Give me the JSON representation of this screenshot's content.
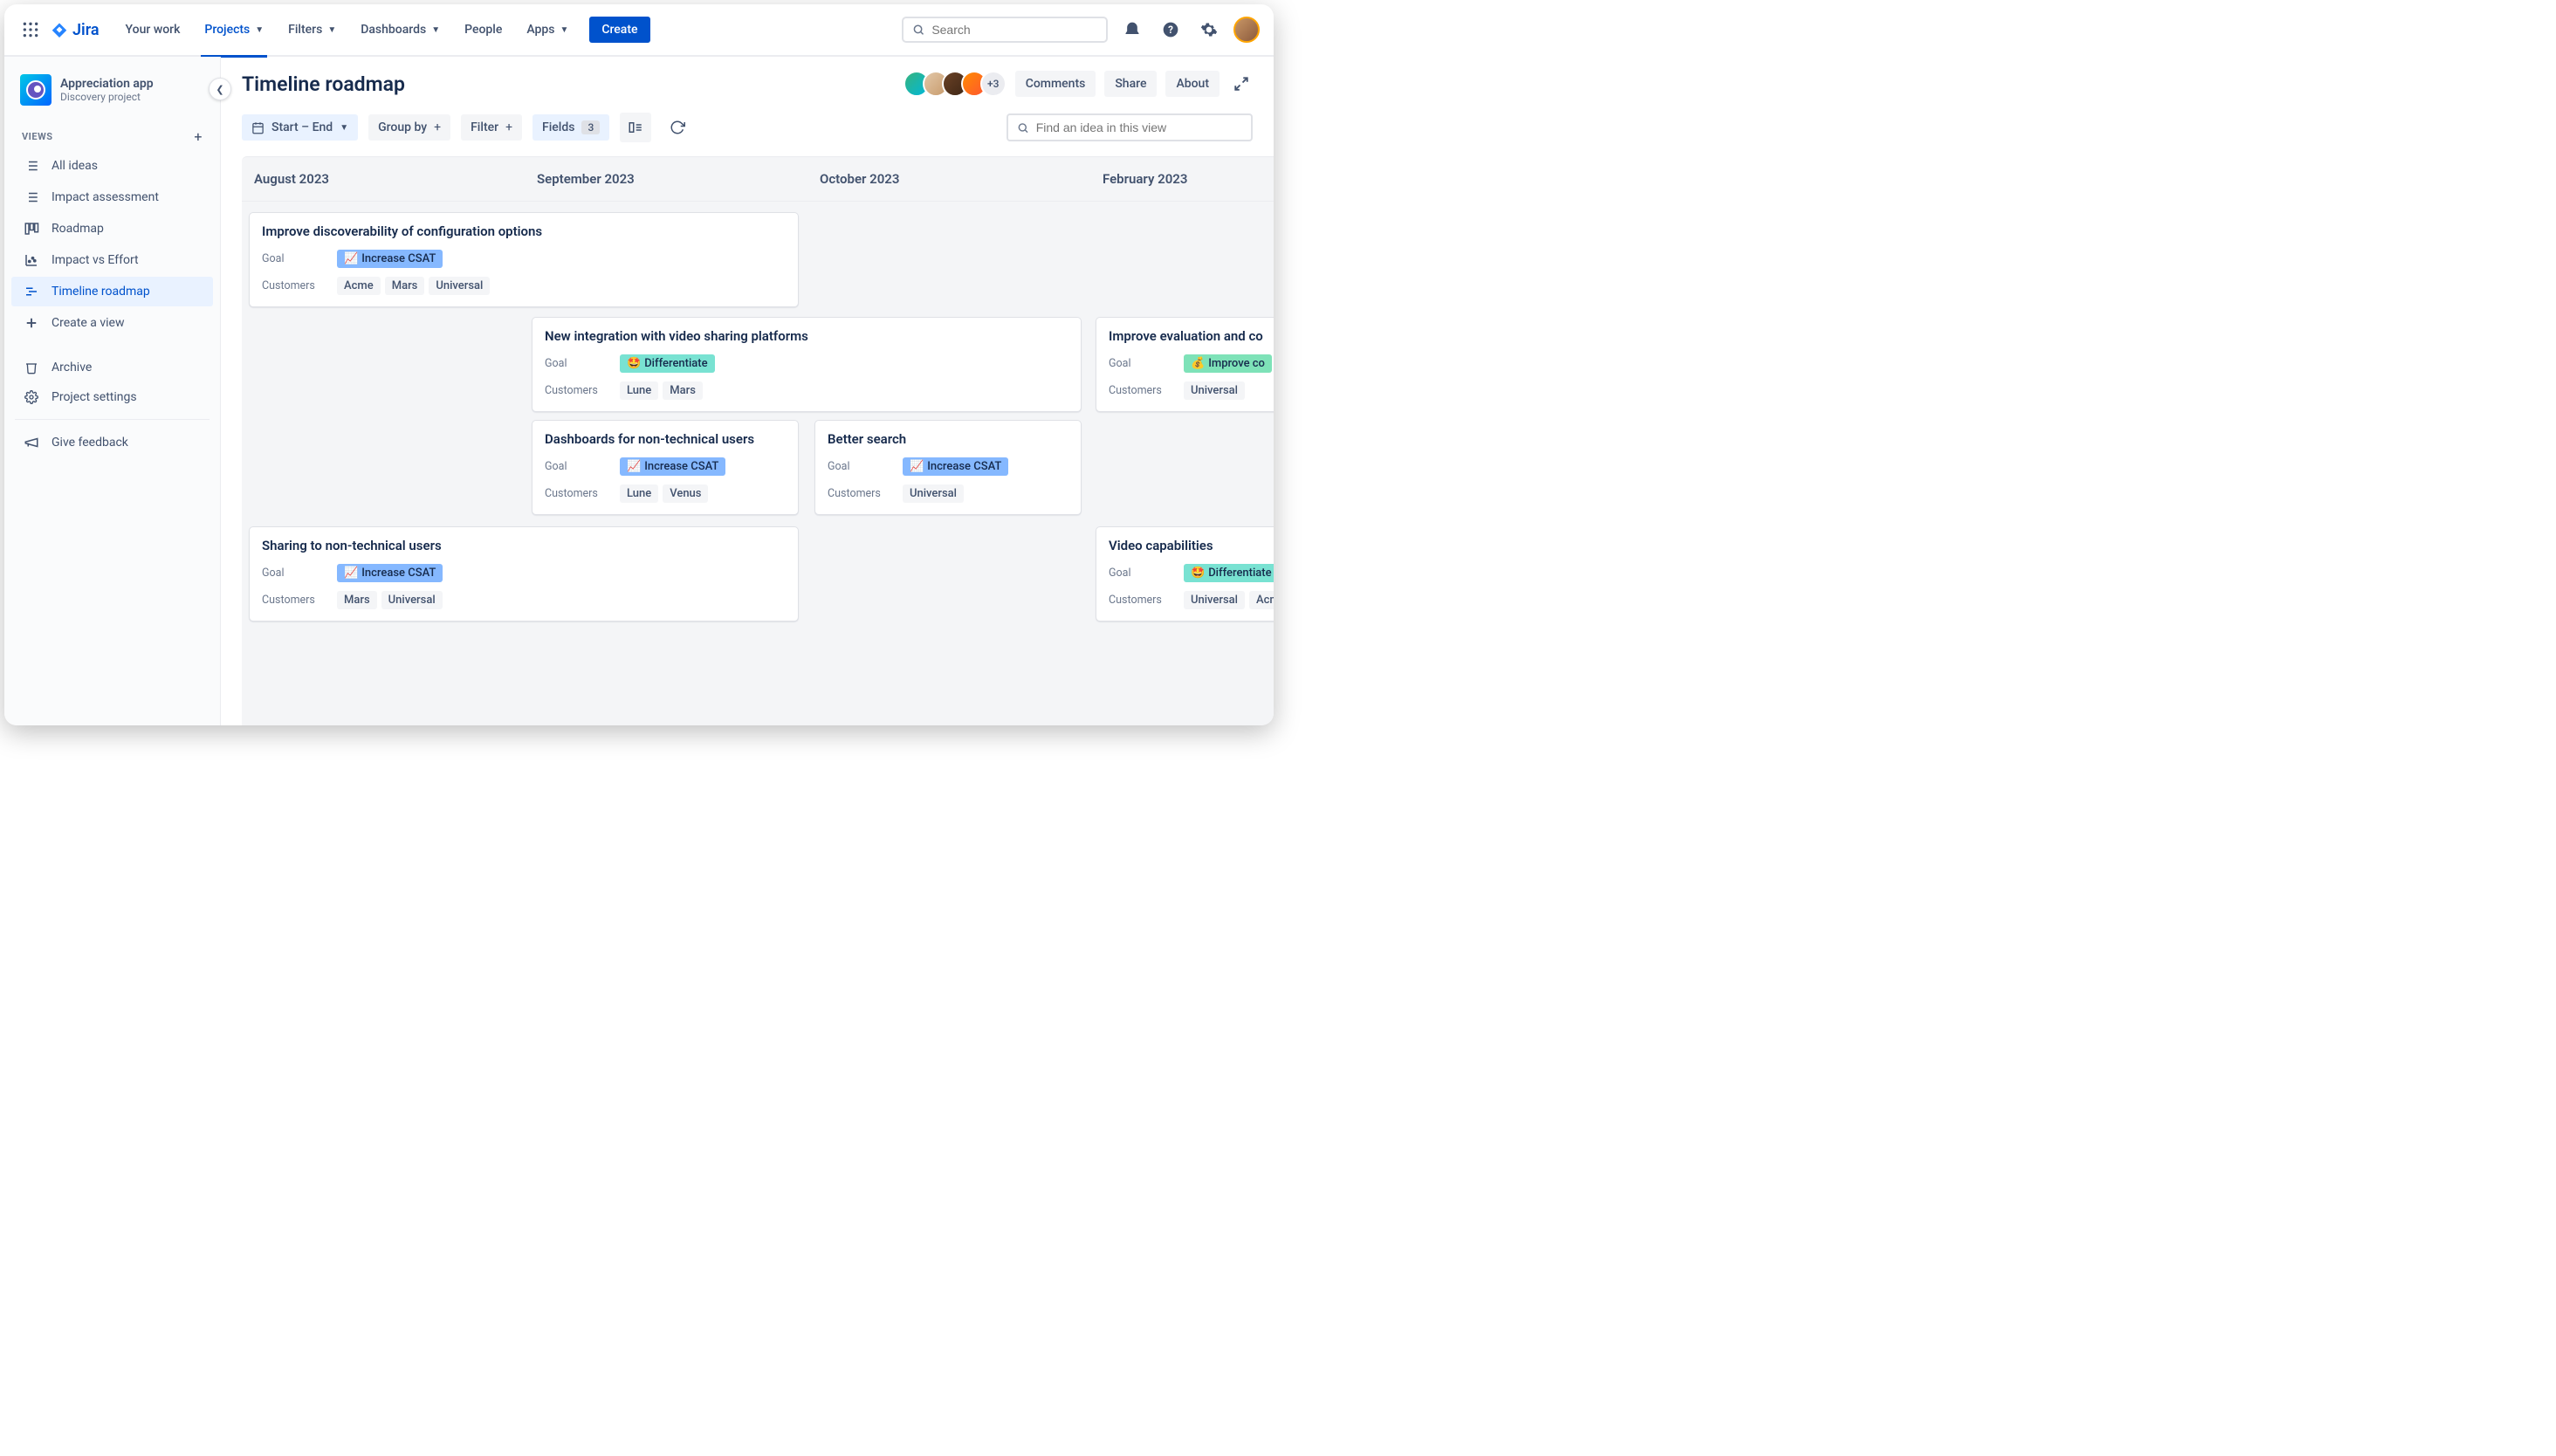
{
  "topbar": {
    "logo": "Jira",
    "nav": {
      "your_work": "Your work",
      "projects": "Projects",
      "filters": "Filters",
      "dashboards": "Dashboards",
      "people": "People",
      "apps": "Apps"
    },
    "create": "Create",
    "search_placeholder": "Search"
  },
  "sidebar": {
    "project_name": "Appreciation app",
    "project_type": "Discovery project",
    "section_views": "VIEWS",
    "items": {
      "all_ideas": "All ideas",
      "impact_assessment": "Impact assessment",
      "roadmap": "Roadmap",
      "impact_vs_effort": "Impact vs Effort",
      "timeline_roadmap": "Timeline roadmap",
      "create_view": "Create a view",
      "archive": "Archive",
      "project_settings": "Project settings",
      "give_feedback": "Give feedback"
    }
  },
  "header": {
    "title": "Timeline roadmap",
    "avatars_more": "+3",
    "buttons": {
      "comments": "Comments",
      "share": "Share",
      "about": "About"
    }
  },
  "controls": {
    "date_chip": "Start – End",
    "group_by": "Group by",
    "filter": "Filter",
    "fields": "Fields",
    "fields_count": "3",
    "find_placeholder": "Find an idea in this view"
  },
  "timeline": {
    "months": [
      "August 2023",
      "September 2023",
      "October 2023",
      "February 2023"
    ],
    "row_labels": {
      "goal": "Goal",
      "customers": "Customers"
    },
    "goals": {
      "increase_csat": "Increase CSAT",
      "differentiate": "Differentiate",
      "improve_co": "Improve co"
    },
    "cards": {
      "c1": {
        "title": "Improve discoverability of configuration options",
        "customers": [
          "Acme",
          "Mars",
          "Universal"
        ]
      },
      "c2": {
        "title": "New integration with video sharing platforms",
        "customers": [
          "Lune",
          "Mars"
        ]
      },
      "c3": {
        "title": "Improve evaluation and co",
        "customers": [
          "Universal"
        ]
      },
      "c4": {
        "title": "Dashboards for non-technical users",
        "customers": [
          "Lune",
          "Venus"
        ]
      },
      "c5": {
        "title": "Better search",
        "customers": [
          "Universal"
        ]
      },
      "c6": {
        "title": "Sharing to non-technical users",
        "customers": [
          "Mars",
          "Universal"
        ]
      },
      "c7": {
        "title": "Video capabilities",
        "customers": [
          "Universal",
          "Acm"
        ]
      }
    }
  }
}
